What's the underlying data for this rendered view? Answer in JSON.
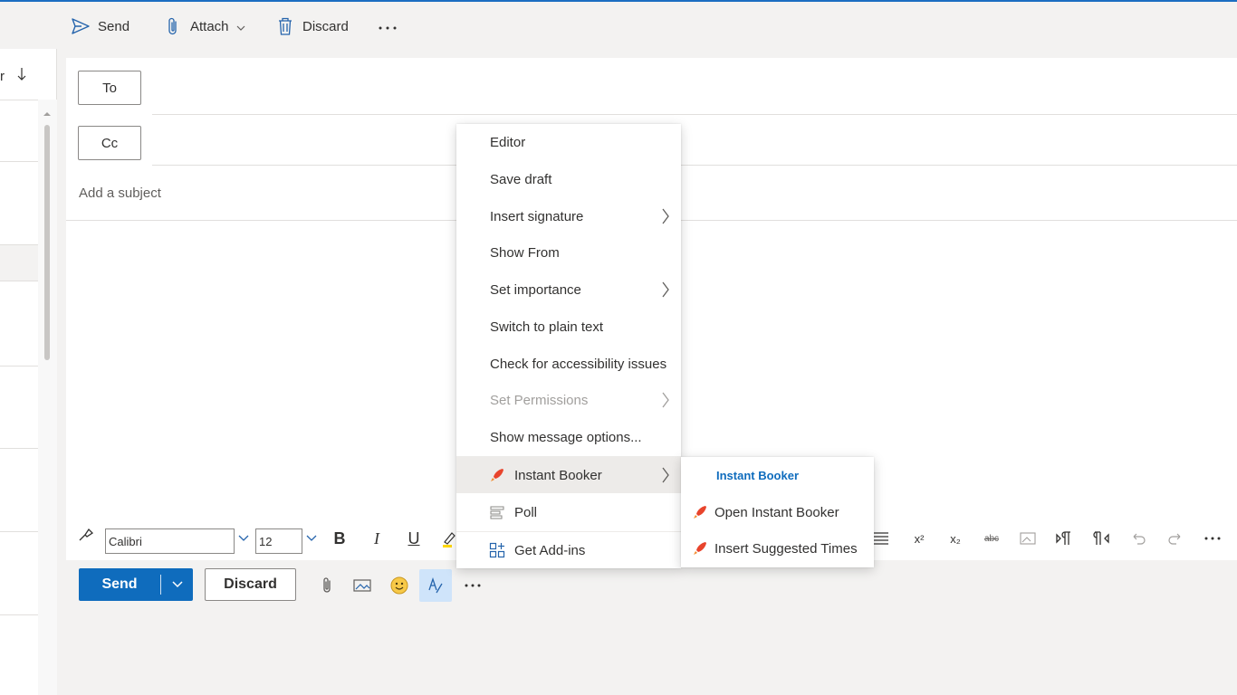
{
  "colors": {
    "accent": "#0f6cbd",
    "addin_icon": "#d13438"
  },
  "commandbar": {
    "send_label": "Send",
    "attach_label": "Attach",
    "discard_label": "Discard",
    "icons": [
      "send-icon",
      "paperclip-icon",
      "chevron-down-icon",
      "trash-icon",
      "more-icon"
    ]
  },
  "leftpane": {
    "sort_label": "r"
  },
  "compose": {
    "to_label": "To",
    "cc_label": "Cc",
    "subject_placeholder": "Add a subject"
  },
  "format_toolbar": {
    "font_name": "Calibri",
    "font_size": "12",
    "bold": "B",
    "italic": "I",
    "underline": "U",
    "superscript": "x²",
    "subscript": "x₂",
    "strikethrough": "abc"
  },
  "send_row": {
    "send_label": "Send",
    "discard_label": "Discard"
  },
  "context_menu": {
    "items": [
      {
        "label": "Editor",
        "submenu": false,
        "disabled": false
      },
      {
        "label": "Save draft",
        "submenu": false,
        "disabled": false
      },
      {
        "label": "Insert signature",
        "submenu": true,
        "disabled": false
      },
      {
        "label": "Show From",
        "submenu": false,
        "disabled": false
      },
      {
        "label": "Set importance",
        "submenu": true,
        "disabled": false
      },
      {
        "label": "Switch to plain text",
        "submenu": false,
        "disabled": false
      },
      {
        "label": "Check for accessibility issues",
        "submenu": false,
        "disabled": false
      },
      {
        "label": "Set Permissions",
        "submenu": true,
        "disabled": true
      },
      {
        "label": "Show message options...",
        "submenu": false,
        "disabled": false
      },
      {
        "label": "Instant Booker",
        "submenu": true,
        "disabled": false,
        "icon": "rocket-icon"
      },
      {
        "label": "Poll",
        "submenu": false,
        "disabled": false,
        "icon": "poll-icon"
      },
      {
        "label": "Get Add-ins",
        "submenu": false,
        "disabled": false,
        "icon": "add-ins-icon"
      }
    ]
  },
  "submenu": {
    "header": "Instant Booker",
    "items": [
      {
        "label": "Open Instant Booker",
        "icon": "rocket-icon"
      },
      {
        "label": "Insert Suggested Times",
        "icon": "rocket-icon"
      }
    ]
  }
}
